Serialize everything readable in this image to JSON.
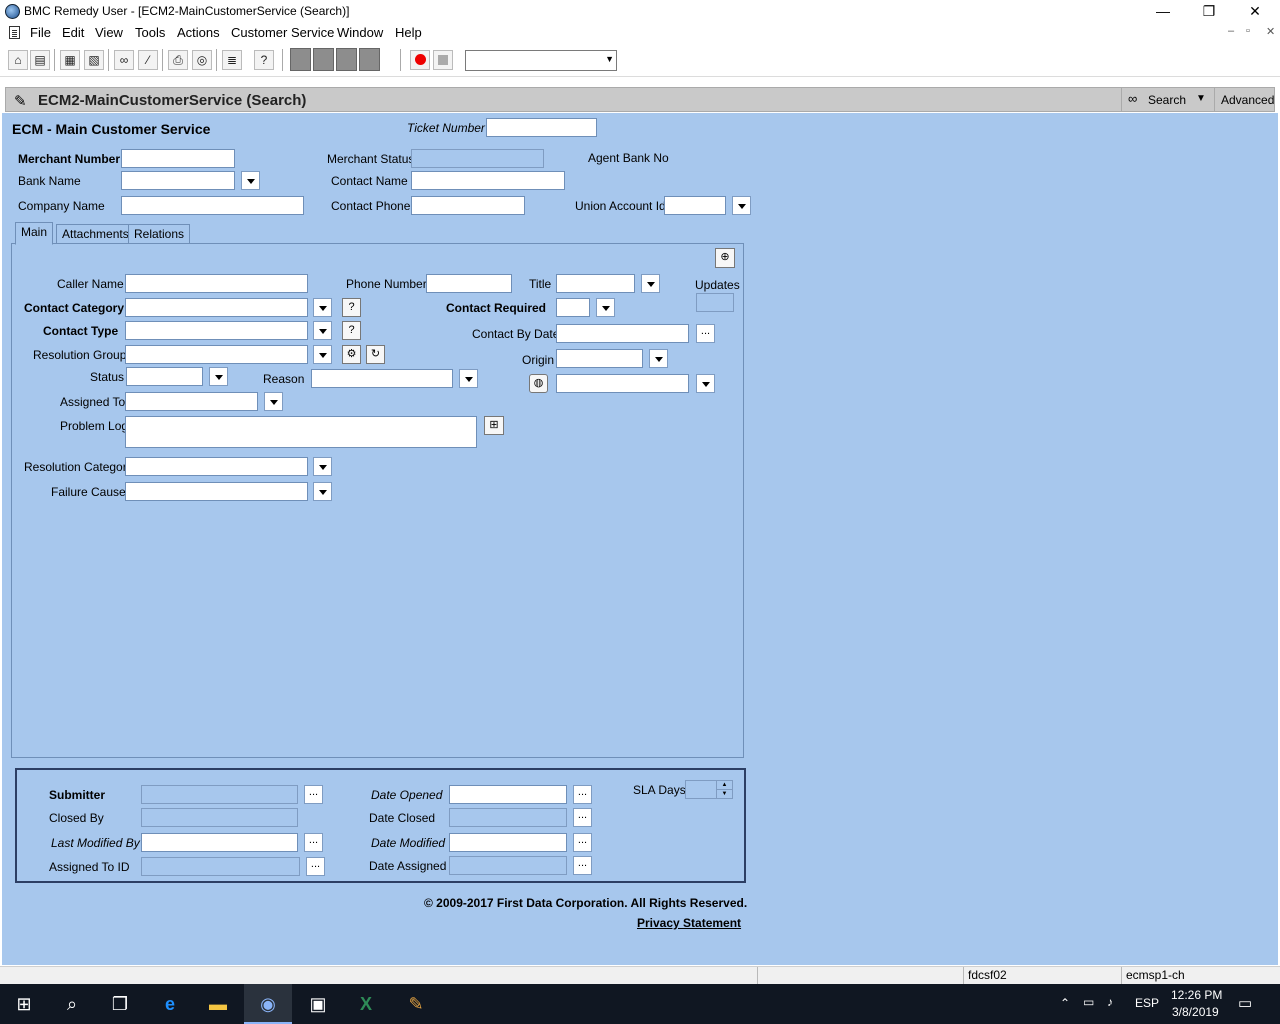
{
  "window": {
    "title": "BMC Remedy User - [ECM2-MainCustomerService (Search)]",
    "minimize": "—",
    "maximize": "❐",
    "close": "✕"
  },
  "menu": {
    "items": [
      "File",
      "Edit",
      "View",
      "Tools",
      "Actions",
      "Customer Service",
      "Window",
      "Help"
    ],
    "mdi_min": "‒",
    "mdi_restore": "▫",
    "mdi_close": "✕"
  },
  "form_header": {
    "title": "ECM2-MainCustomerService (Search)",
    "search_label": "Search",
    "advanced_label": "Advanced"
  },
  "form": {
    "heading": "ECM - Main Customer Service",
    "ticket_number_label": "Ticket Number",
    "merchant_number_label": "Merchant Number",
    "merchant_status_label": "Merchant Status",
    "agent_bank_no_label": "Agent Bank No",
    "bank_name_label": "Bank Name",
    "contact_name_label": "Contact Name",
    "company_name_label": "Company Name",
    "contact_phone_label": "Contact Phone",
    "union_account_id_label": "Union Account Id"
  },
  "tabs": [
    "Main",
    "Attachments",
    "Relations"
  ],
  "main_tab": {
    "caller_name_label": "Caller Name",
    "phone_number_label": "Phone Number",
    "title_label": "Title",
    "updates_label": "Updates",
    "contact_category_label": "Contact Category",
    "contact_required_label": "Contact Required",
    "contact_type_label": "Contact Type",
    "contact_by_date_label": "Contact By Date",
    "resolution_group_label": "Resolution Group",
    "origin_label": "Origin",
    "status_label": "Status",
    "reason_label": "Reason",
    "assigned_to_label": "Assigned To",
    "problem_log_label": "Problem Log",
    "resolution_category_label": "Resolution Category",
    "failure_cause_label": "Failure Cause"
  },
  "bottom": {
    "submitter_label": "Submitter",
    "closed_by_label": "Closed By",
    "last_modified_by_label": "Last Modified By",
    "assigned_to_id_label": "Assigned To ID",
    "date_opened_label": "Date Opened",
    "date_closed_label": "Date Closed",
    "date_modified_label": "Date Modified",
    "date_assigned_label": "Date Assigned",
    "sla_days_label": "SLA Days",
    "ellipsis": "..."
  },
  "footer": {
    "copyright": "© 2009-2017 First Data Corporation. All Rights Reserved.",
    "privacy": "Privacy Statement"
  },
  "statusbar": {
    "server": "fdcsf02",
    "host": "ecmsp1-ch"
  },
  "taskbar": {
    "language": "ESP",
    "time": "12:26 PM",
    "date": "3/8/2019"
  }
}
